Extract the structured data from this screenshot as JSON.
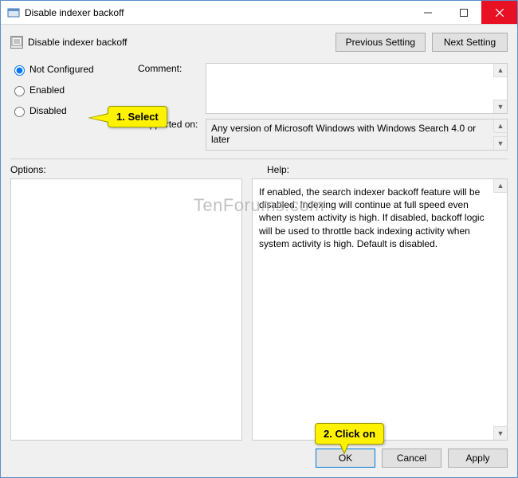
{
  "titlebar": {
    "title": "Disable indexer backoff"
  },
  "header": {
    "policy_title": "Disable indexer backoff",
    "previous": "Previous Setting",
    "next": "Next Setting"
  },
  "radios": {
    "not_configured": "Not Configured",
    "enabled": "Enabled",
    "disabled": "Disabled"
  },
  "labels": {
    "comment": "Comment:",
    "supported_on": "Supported on:",
    "options": "Options:",
    "help": "Help:"
  },
  "supported_text": "Any version of Microsoft Windows with Windows Search 4.0 or later",
  "help_text": "If enabled, the search indexer backoff feature will be disabled. Indexing will continue at full speed even when system activity is high. If disabled, backoff logic will be used to throttle back indexing activity when system activity is high. Default is disabled.",
  "buttons": {
    "ok": "OK",
    "cancel": "Cancel",
    "apply": "Apply"
  },
  "callouts": {
    "select": "1. Select",
    "click_on": "2. Click on"
  },
  "watermark": "TenForums.com"
}
